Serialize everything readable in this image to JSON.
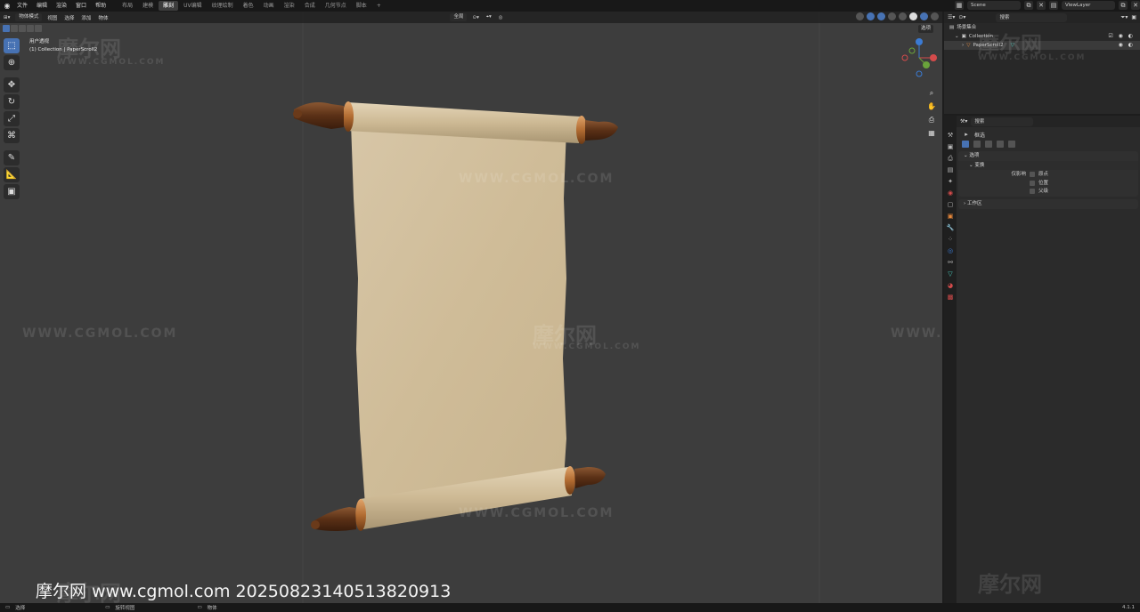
{
  "topbar": {
    "menus": [
      "文件",
      "编辑",
      "渲染",
      "窗口",
      "帮助"
    ],
    "workspaces": [
      "布局",
      "建模",
      "雕刻",
      "UV编辑",
      "纹理绘制",
      "着色",
      "动画",
      "渲染",
      "合成",
      "几何节点",
      "脚本",
      "+"
    ],
    "active_workspace_index": 2,
    "scene": "Scene",
    "view_layer": "ViewLayer"
  },
  "viewport": {
    "mode": "物体模式",
    "header_menus": [
      "视图",
      "选择",
      "添加",
      "物体"
    ],
    "transform_orientation": "全局",
    "view_name": "用户透视",
    "collection_path": "(1) Collection | PaperScroll2",
    "options_label": "选项"
  },
  "watermarks": {
    "cn": "摩尔网",
    "url": "WWW.CGMOL.COM"
  },
  "stamp": "摩尔网 www.cgmol.com 20250823140513820913",
  "outliner": {
    "search_placeholder": "搜索",
    "root": "场景集合",
    "collection": "Collection",
    "object": "PaperScroll2"
  },
  "properties": {
    "search_placeholder": "搜索",
    "tool_name": "框选",
    "panel_options": "选项",
    "sub_transform": "变换",
    "affect_only_label": "仅影响",
    "affect_items": [
      "原点",
      "位置",
      "父级"
    ],
    "panel_workspace": "工作区"
  },
  "statusbar": {
    "select": "选择",
    "rotate_view": "旋转视图",
    "object": "物体",
    "version": "4.1.1"
  }
}
